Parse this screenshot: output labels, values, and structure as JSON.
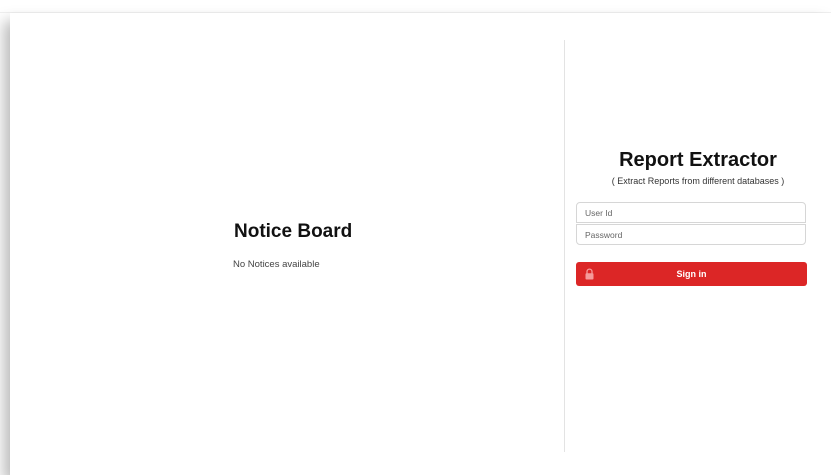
{
  "notice_board": {
    "title": "Notice Board",
    "empty_text": "No Notices available"
  },
  "login": {
    "app_title": "Report Extractor",
    "app_subtitle": "( Extract Reports from different databases )",
    "user_id": {
      "placeholder": "User Id",
      "value": ""
    },
    "password": {
      "placeholder": "Password",
      "value": ""
    },
    "sign_in_label": "Sign in",
    "sign_in_icon": "lock-icon"
  },
  "colors": {
    "accent": "#dc2626",
    "background": "#ffffff",
    "divider": "#e3e3e3"
  }
}
